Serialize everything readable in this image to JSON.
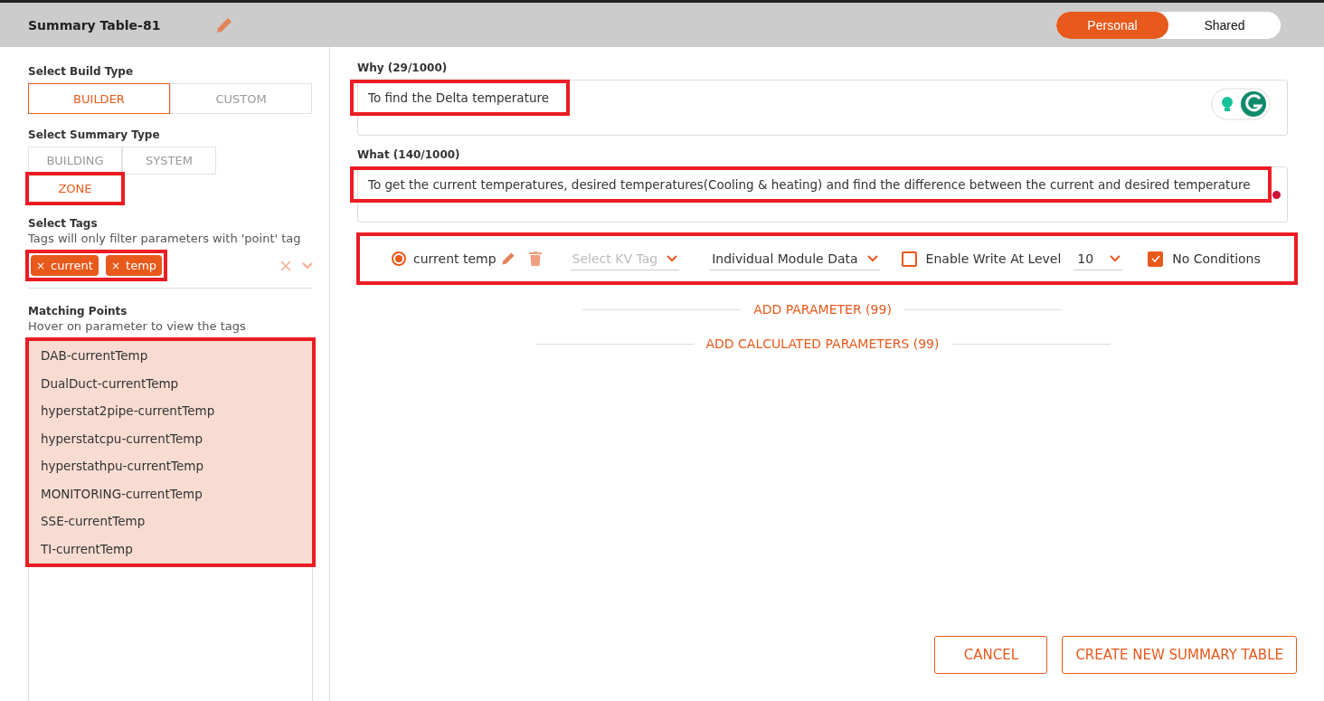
{
  "header": {
    "title": "Summary Table-81",
    "scope_toggle": [
      {
        "label": "Personal",
        "selected": true
      },
      {
        "label": "Shared",
        "selected": false
      }
    ]
  },
  "build_type": {
    "label": "Select Build Type",
    "options": [
      {
        "label": "BUILDER",
        "selected": true
      },
      {
        "label": "CUSTOM",
        "selected": false
      }
    ]
  },
  "summary_type": {
    "label": "Select Summary Type",
    "options": [
      {
        "label": "BUILDING",
        "selected": false,
        "highlighted": false
      },
      {
        "label": "SYSTEM",
        "selected": false,
        "highlighted": false
      },
      {
        "label": "ZONE",
        "selected": true,
        "highlighted": true
      }
    ]
  },
  "tags": {
    "label": "Select Tags",
    "hint": "Tags will only filter parameters with 'point' tag",
    "highlighted": true,
    "chips": [
      {
        "remove": "×",
        "label": "current"
      },
      {
        "remove": "×",
        "label": "temp"
      }
    ]
  },
  "matching_points": {
    "label": "Matching Points",
    "hint": "Hover on parameter to view the tags",
    "highlighted": true,
    "items": [
      "DAB-currentTemp",
      "DualDuct-currentTemp",
      "hyperstat2pipe-currentTemp",
      "hyperstatcpu-currentTemp",
      "hyperstathpu-currentTemp",
      "MONITORING-currentTemp",
      "SSE-currentTemp",
      "TI-currentTemp"
    ]
  },
  "why": {
    "label": "Why (29/1000)",
    "value": "To find the Delta temperature",
    "highlighted": true
  },
  "what": {
    "label": "What (140/1000)",
    "value": "To get the current temperatures, desired temperatures(Cooling & heating) and find the difference between the current and desired temperature",
    "highlighted": true
  },
  "parameter": {
    "highlighted": true,
    "selected": true,
    "name": "current temp",
    "kv_tag": {
      "placeholder": "Select KV Tag"
    },
    "data_mode": "Individual Module Data",
    "enable_write": {
      "label": "Enable Write At Level",
      "checked": false
    },
    "level": "10",
    "no_conditions": {
      "label": "No Conditions",
      "checked": true
    }
  },
  "add_actions": [
    "ADD PARAMETER (99)",
    "ADD CALCULATED PARAMETERS (99)"
  ],
  "buttons": [
    {
      "label": "CANCEL"
    },
    {
      "label": "CREATE NEW SUMMARY TABLE"
    }
  ]
}
